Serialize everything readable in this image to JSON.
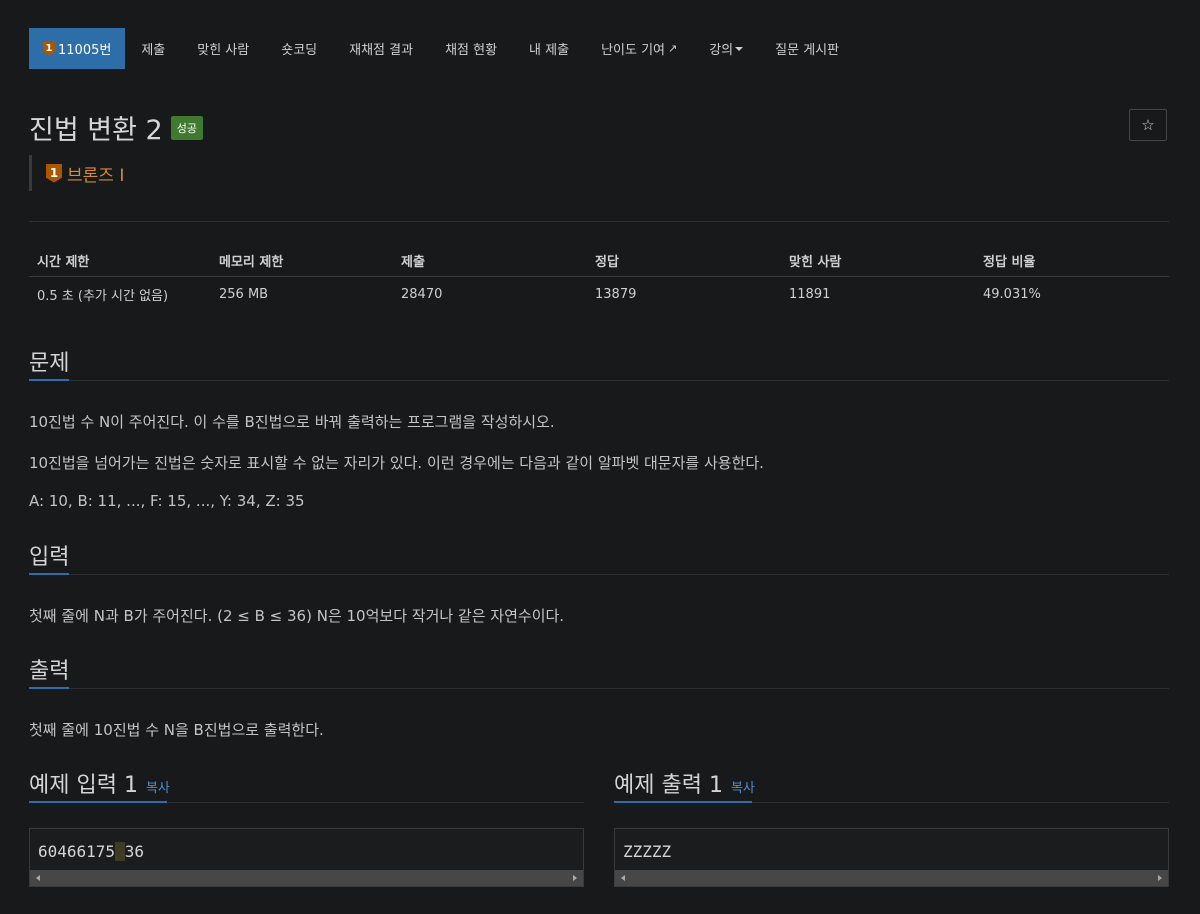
{
  "nav": {
    "problem_tier": "1",
    "problem_number": "11005번",
    "items": [
      {
        "label": "제출"
      },
      {
        "label": "맞힌 사람"
      },
      {
        "label": "숏코딩"
      },
      {
        "label": "재채점 결과"
      },
      {
        "label": "채점 현황"
      },
      {
        "label": "내 제출"
      },
      {
        "label": "난이도 기여"
      },
      {
        "label": "강의"
      },
      {
        "label": "질문 게시판"
      }
    ]
  },
  "problem": {
    "title": "진법 변환 2",
    "status_badge": "성공",
    "star": "☆",
    "tier_icon": "1",
    "tier_label": "브론즈 I"
  },
  "info": {
    "headers": [
      "시간 제한",
      "메모리 제한",
      "제출",
      "정답",
      "맞힌 사람",
      "정답 비율"
    ],
    "values": [
      "0.5 초 (추가 시간 없음)",
      "256 MB",
      "28470",
      "13879",
      "11891",
      "49.031%"
    ]
  },
  "sections": {
    "description": {
      "heading": "문제",
      "paragraphs": [
        "10진법 수 N이 주어진다. 이 수를 B진법으로 바꿔 출력하는 프로그램을 작성하시오.",
        "10진법을 넘어가는 진법은 숫자로 표시할 수 없는 자리가 있다. 이런 경우에는 다음과 같이 알파벳 대문자를 사용한다.",
        "A: 10, B: 11, ..., F: 15, ..., Y: 34, Z: 35"
      ]
    },
    "input": {
      "heading": "입력",
      "text": "첫째 줄에 N과 B가 주어진다. (2 ≤ B ≤ 36) N은 10억보다 작거나 같은 자연수이다."
    },
    "output": {
      "heading": "출력",
      "text": "첫째 줄에 10진법 수 N을 B진법으로 출력한다."
    }
  },
  "samples": {
    "input": {
      "heading": "예제 입력 1",
      "copy": "복사",
      "text_a": "60466175",
      "text_b": " ",
      "text_c": "36"
    },
    "output": {
      "heading": "예제 출력 1",
      "copy": "복사",
      "text": "ZZZZZ"
    }
  },
  "colors": {
    "background": "#18191b",
    "nav_active": "#2d6ea8",
    "success": "#3f7a2f",
    "bronze": "#ad5600",
    "link": "#4d8fd6"
  }
}
